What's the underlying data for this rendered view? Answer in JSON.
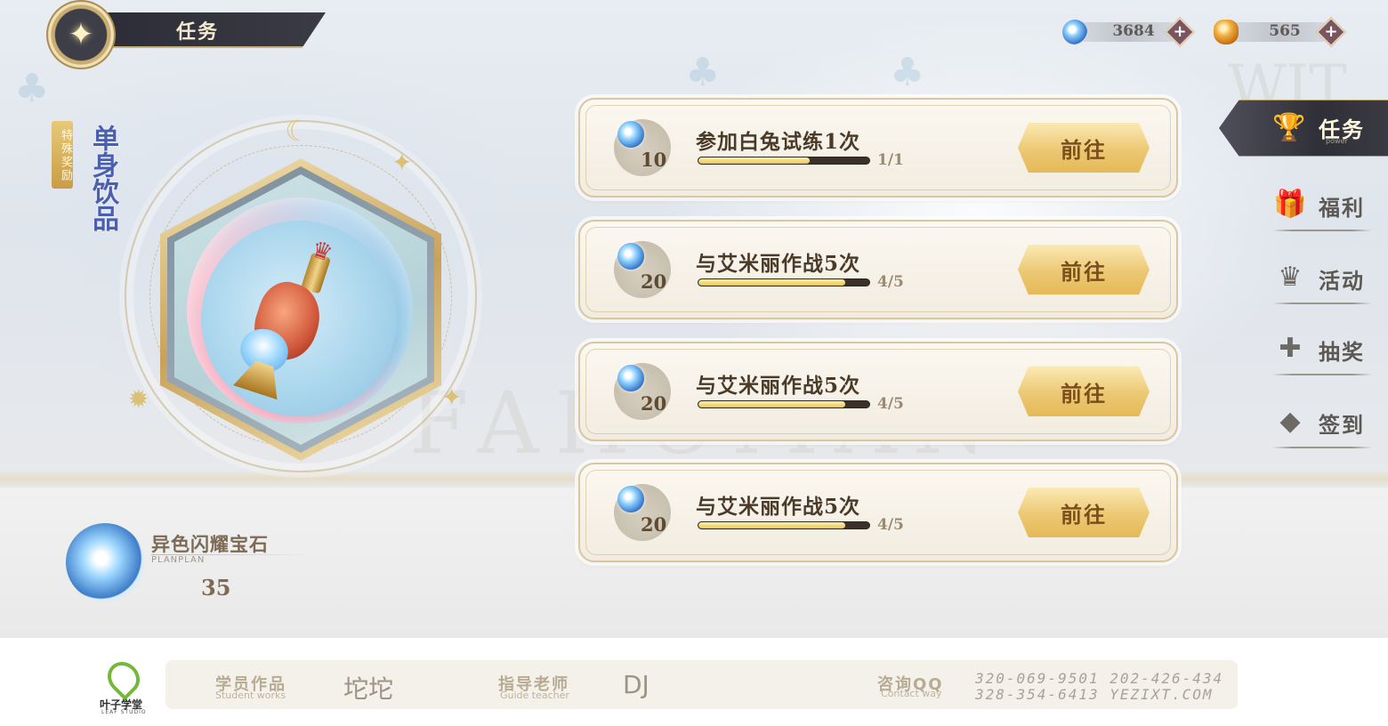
{
  "header": {
    "title": "任务"
  },
  "currency": [
    {
      "icon": "blue-gem-icon",
      "value": "3684",
      "add": "+"
    },
    {
      "icon": "amber-crystal-icon",
      "value": "565",
      "add": "+"
    }
  ],
  "featured": {
    "badge": "特殊奖励",
    "title": "单身饮品",
    "item_icon": "potion-vase-icon",
    "gem_name": "异色闪耀宝石",
    "gem_sub": "PLANPLAN",
    "gem_qty": "35"
  },
  "background": {
    "watermark": "FAHOMAN",
    "watermark2": "WIT"
  },
  "tasks": [
    {
      "reward": "10",
      "name": "参加白兔试练1次",
      "progress_text": "1/1",
      "progress": 0.65,
      "button": "前往"
    },
    {
      "reward": "20",
      "name": "与艾米丽作战5次",
      "progress_text": "4/5",
      "progress": 0.86,
      "button": "前往"
    },
    {
      "reward": "20",
      "name": "与艾米丽作战5次",
      "progress_text": "4/5",
      "progress": 0.86,
      "button": "前往"
    },
    {
      "reward": "20",
      "name": "与艾米丽作战5次",
      "progress_text": "4/5",
      "progress": 0.86,
      "button": "前往"
    }
  ],
  "nav": {
    "active": {
      "label": "任务",
      "sub": "power",
      "icon": "trophy-icon"
    },
    "items": [
      {
        "label": "福利",
        "icon": "gift-icon"
      },
      {
        "label": "活动",
        "icon": "crown-icon"
      },
      {
        "label": "抽奖",
        "icon": "puzzle-icon"
      },
      {
        "label": "签到",
        "icon": "card-icon"
      }
    ]
  },
  "footer": {
    "logo": "叶子学堂",
    "logo_sub": "LEAF STUDIO",
    "student_label": "学员作品",
    "student_sub": "Student works",
    "student_name": "坨坨",
    "teacher_label": "指导老师",
    "teacher_sub": "Guide teacher",
    "teacher_name": "DJ",
    "contact_label": "咨询QQ",
    "contact_sub": "Contact way",
    "contact_line1": "320-069-9501 202-426-434",
    "contact_line2": "328-354-6413 YEZIXT.COM"
  }
}
